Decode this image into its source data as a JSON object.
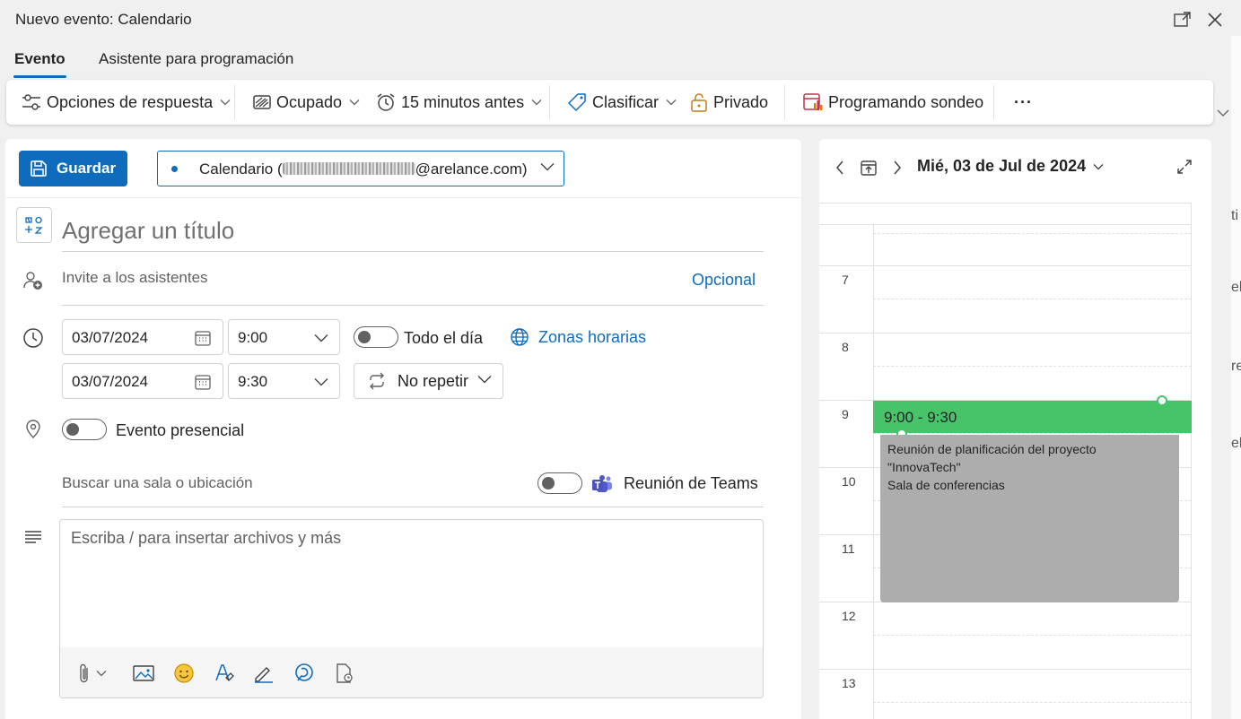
{
  "window": {
    "title": "Nuevo evento: Calendario"
  },
  "tabs": [
    {
      "label": "Evento",
      "active": true
    },
    {
      "label": "Asistente para programación",
      "active": false
    }
  ],
  "ribbon": {
    "response_options": "Opciones de respuesta",
    "show_as": "Ocupado",
    "reminder": "15 minutos antes",
    "categorize": "Clasificar",
    "private": "Privado",
    "scheduling_poll": "Programando sondeo",
    "more": "···"
  },
  "save_button": {
    "label": "Guardar"
  },
  "calendar_select": {
    "prefix": "Calendario (",
    "suffix": "@arelance.com)"
  },
  "event_title": {
    "placeholder": "Agregar un título"
  },
  "attendees": {
    "placeholder": "Invite a los asistentes",
    "optional_link": "Opcional"
  },
  "start": {
    "date": "03/07/2024",
    "time": "9:00"
  },
  "end": {
    "date": "03/07/2024",
    "time": "9:30"
  },
  "all_day": {
    "label": "Todo el día",
    "on": false
  },
  "time_zones": {
    "label": "Zonas horarias"
  },
  "repeat": {
    "label": "No repetir"
  },
  "in_person": {
    "label": "Evento presencial",
    "on": false
  },
  "location": {
    "placeholder": "Buscar una sala o ubicación"
  },
  "teams": {
    "label": "Reunión de Teams",
    "on": false
  },
  "body": {
    "placeholder": "Escriba / para insertar archivos y más"
  },
  "body_toolbar_icons": [
    "paperclip-icon",
    "image-icon",
    "emoji-icon",
    "format-paint-icon",
    "pen-icon",
    "loop-icon",
    "document-icon"
  ],
  "calendar_panel": {
    "date_label": "Mié, 03 de Jul de 2024",
    "hours": [
      "7",
      "8",
      "9",
      "10",
      "11",
      "12",
      "13"
    ],
    "event": {
      "time_range": "9:00 - 9:30",
      "title_line1": "Reunión de planificación del proyecto",
      "title_line2": "\"InnovaTech\"",
      "location": "Sala de conferencias"
    }
  },
  "colors": {
    "accent": "#0f6cbd",
    "event_green": "#47c46a",
    "event_gray": "#adadad",
    "poll_icon": "#c4314b"
  }
}
